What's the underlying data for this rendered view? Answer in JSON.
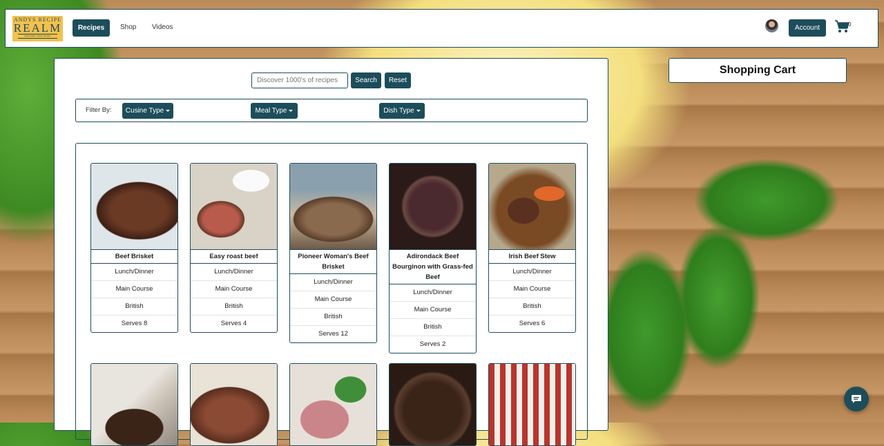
{
  "header": {
    "logo": {
      "line1": "ANDYS RECIPE",
      "line2": "REALM",
      "tagline": "DISCOVER. COOK. ENJOY."
    },
    "nav": [
      {
        "label": "Recipes",
        "active": true
      },
      {
        "label": "Shop",
        "active": false
      },
      {
        "label": "Videos",
        "active": false
      }
    ],
    "account_label": "Account",
    "cart_count": "0"
  },
  "search": {
    "placeholder": "Discover 1000's of recipes",
    "value": "",
    "search_label": "Search",
    "reset_label": "Reset"
  },
  "filters": {
    "label": "Filter By:",
    "dropdowns": [
      {
        "label": "Cusine Type"
      },
      {
        "label": "Meal Type"
      },
      {
        "label": "Dish Type"
      }
    ]
  },
  "cart_panel": {
    "title": "Shopping Cart"
  },
  "recipes": [
    {
      "title": "Beef Brisket",
      "meal": "Lunch/Dinner",
      "dish": "Main Course",
      "cuisine": "British",
      "serves": "Serves 8"
    },
    {
      "title": "Easy roast beef",
      "meal": "Lunch/Dinner",
      "dish": "Main Course",
      "cuisine": "British",
      "serves": "Serves 4"
    },
    {
      "title": "Pioneer Woman's Beef Brisket",
      "meal": "Lunch/Dinner",
      "dish": "Main Course",
      "cuisine": "British",
      "serves": "Serves 12"
    },
    {
      "title": "Adirondack Beef Bourginon with Grass-fed Beef",
      "meal": "Lunch/Dinner",
      "dish": "Main Course",
      "cuisine": "British",
      "serves": "Serves 2"
    },
    {
      "title": "Irish Beef Stew",
      "meal": "Lunch/Dinner",
      "dish": "Main Course",
      "cuisine": "British",
      "serves": "Serves 6"
    }
  ],
  "colors": {
    "primary": "#1d4d5a",
    "logo_bg": "#f2c14e"
  }
}
